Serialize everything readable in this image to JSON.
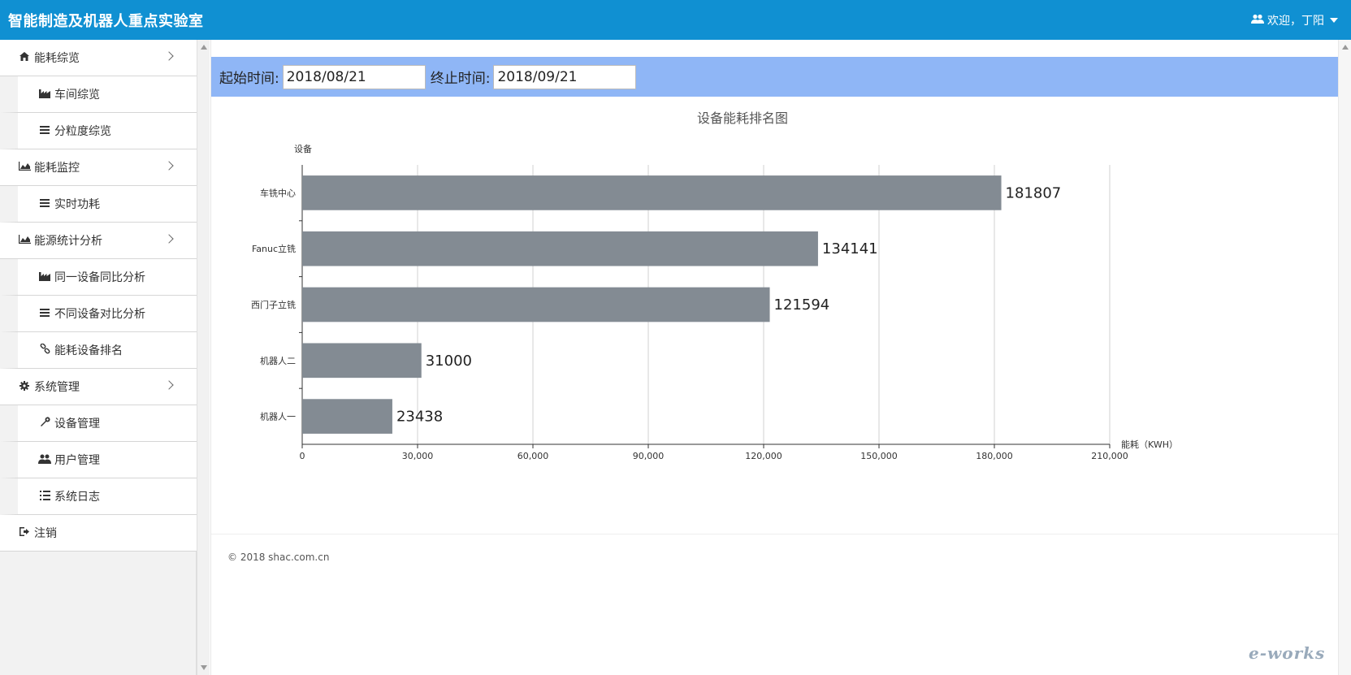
{
  "header": {
    "brand": "智能制造及机器人重点实验室",
    "welcome": "欢迎，丁阳"
  },
  "sidebar": {
    "items": [
      {
        "label": "能耗综览",
        "level": "top",
        "icon": "home-icon",
        "expandable": true
      },
      {
        "label": "车间综览",
        "level": "sub",
        "icon": "factory-icon"
      },
      {
        "label": "分粒度综览",
        "level": "sub",
        "icon": "list-icon"
      },
      {
        "label": "能耗监控",
        "level": "top",
        "icon": "area-chart-icon",
        "expandable": true
      },
      {
        "label": "实时功耗",
        "level": "sub",
        "icon": "list-icon"
      },
      {
        "label": "能源统计分析",
        "level": "top",
        "icon": "area-chart-icon",
        "expandable": true
      },
      {
        "label": "同一设备同比分析",
        "level": "sub",
        "icon": "factory-icon"
      },
      {
        "label": "不同设备对比分析",
        "level": "sub",
        "icon": "list-icon"
      },
      {
        "label": "能耗设备排名",
        "level": "sub",
        "icon": "link-icon"
      },
      {
        "label": "系统管理",
        "level": "top",
        "icon": "gear-icon",
        "expandable": true
      },
      {
        "label": "设备管理",
        "level": "sub",
        "icon": "wrench-icon"
      },
      {
        "label": "用户管理",
        "level": "sub",
        "icon": "users-icon"
      },
      {
        "label": "系统日志",
        "level": "sub",
        "icon": "list-ol-icon"
      },
      {
        "label": "注销",
        "level": "top",
        "icon": "sign-out-icon",
        "expandable": false
      }
    ]
  },
  "filter": {
    "start_label": "起始时间:",
    "start_value": "2018/08/21",
    "end_label": "终止时间:",
    "end_value": "2018/09/21"
  },
  "chart_data": {
    "type": "bar",
    "orientation": "horizontal",
    "title": "设备能耗排名图",
    "ylabel": "设备",
    "xlabel": "能耗（KWH）",
    "categories": [
      "车铣中心",
      "Fanuc立铣",
      "西门子立铣",
      "机器人二",
      "机器人一"
    ],
    "values": [
      181807,
      134141,
      121594,
      31000,
      23438
    ],
    "xlim": [
      0,
      210000
    ],
    "xticks": [
      0,
      30000,
      60000,
      90000,
      120000,
      150000,
      180000,
      210000
    ],
    "xtick_labels": [
      "0",
      "30,000",
      "60,000",
      "90,000",
      "120,000",
      "150,000",
      "180,000",
      "210,000"
    ],
    "grid": true,
    "bar_color": "#838b93"
  },
  "footer": {
    "copyright": "© 2018 shac.com.cn",
    "watermark": "e-works"
  }
}
